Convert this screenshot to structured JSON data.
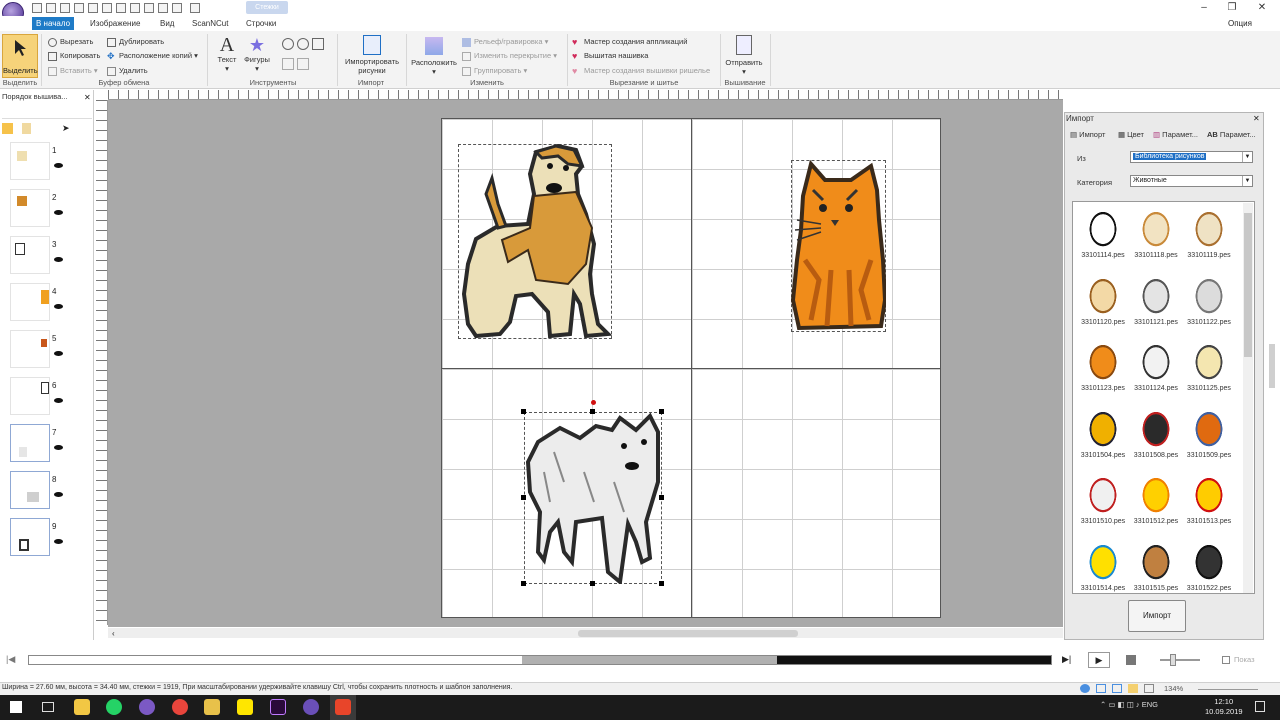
{
  "title": {
    "window_tab": "Стежки"
  },
  "window_controls": [
    "–",
    "❐",
    "✕"
  ],
  "tabs": [
    "В начало",
    "Изображение",
    "Вид",
    "ScanNCut",
    "Строчки"
  ],
  "options_label": "Опция",
  "ribbon": {
    "select": "Выделить",
    "clipboard": {
      "cut": "Вырезать",
      "copy": "Копировать",
      "paste": "Вставить",
      "duplicate": "Дублировать",
      "arrange": "Расположение копий",
      "delete": "Удалить",
      "label": "Буфер обмена"
    },
    "tools": {
      "text": "Текст",
      "shapes": "Фигуры",
      "label": "Инструменты"
    },
    "import": {
      "button": "Импортировать рисунки",
      "label": "Импорт"
    },
    "arrange": {
      "button": "Расположить",
      "relief": "Рельеф/гравировка",
      "overlap": "Изменить перекрытие",
      "group": "Группировать",
      "label": "Изменить"
    },
    "cutting": {
      "applique": "Мастер создания аппликаций",
      "stitch": "Вышитая нашивка",
      "embroidery": "Мастер создания вышивки ришелье",
      "label": "Вырезание и шитье"
    },
    "send": {
      "button": "Отправить",
      "label": "Вышивание"
    },
    "select_group_label": "Выделить"
  },
  "left_panel": {
    "title": "Порядок вышива...",
    "items": [
      "1",
      "2",
      "3",
      "4",
      "5",
      "6",
      "7",
      "8",
      "9"
    ]
  },
  "import_panel": {
    "title": "Импорт",
    "tabs": [
      "Импорт",
      "Цвет",
      "Парамет...",
      "Парамет..."
    ],
    "from_label": "Из",
    "from_value": "Библиотека рисунков",
    "category_label": "Категория",
    "category_value": "Животные",
    "thumbnails": [
      "33101114.pes",
      "33101118.pes",
      "33101119.pes",
      "33101120.pes",
      "33101121.pes",
      "33101122.pes",
      "33101123.pes",
      "33101124.pes",
      "33101125.pes",
      "33101504.pes",
      "33101508.pes",
      "33101509.pes",
      "33101510.pes",
      "33101512.pes",
      "33101513.pes",
      "33101514.pes",
      "33101515.pes",
      "33101522.pes"
    ],
    "import_button": "Импорт"
  },
  "status_text": "Ширина = 27.60 мм, высота = 34.40 мм, стежки = 1919, При масштабировании удерживайте клавишу Ctrl, чтобы сохранить плотность и шаблон заполнения.",
  "zoom": "134%",
  "preview_label": "Показ",
  "taskbar": {
    "lang": "ENG",
    "time": "12:10",
    "date": "10.09.2019"
  }
}
